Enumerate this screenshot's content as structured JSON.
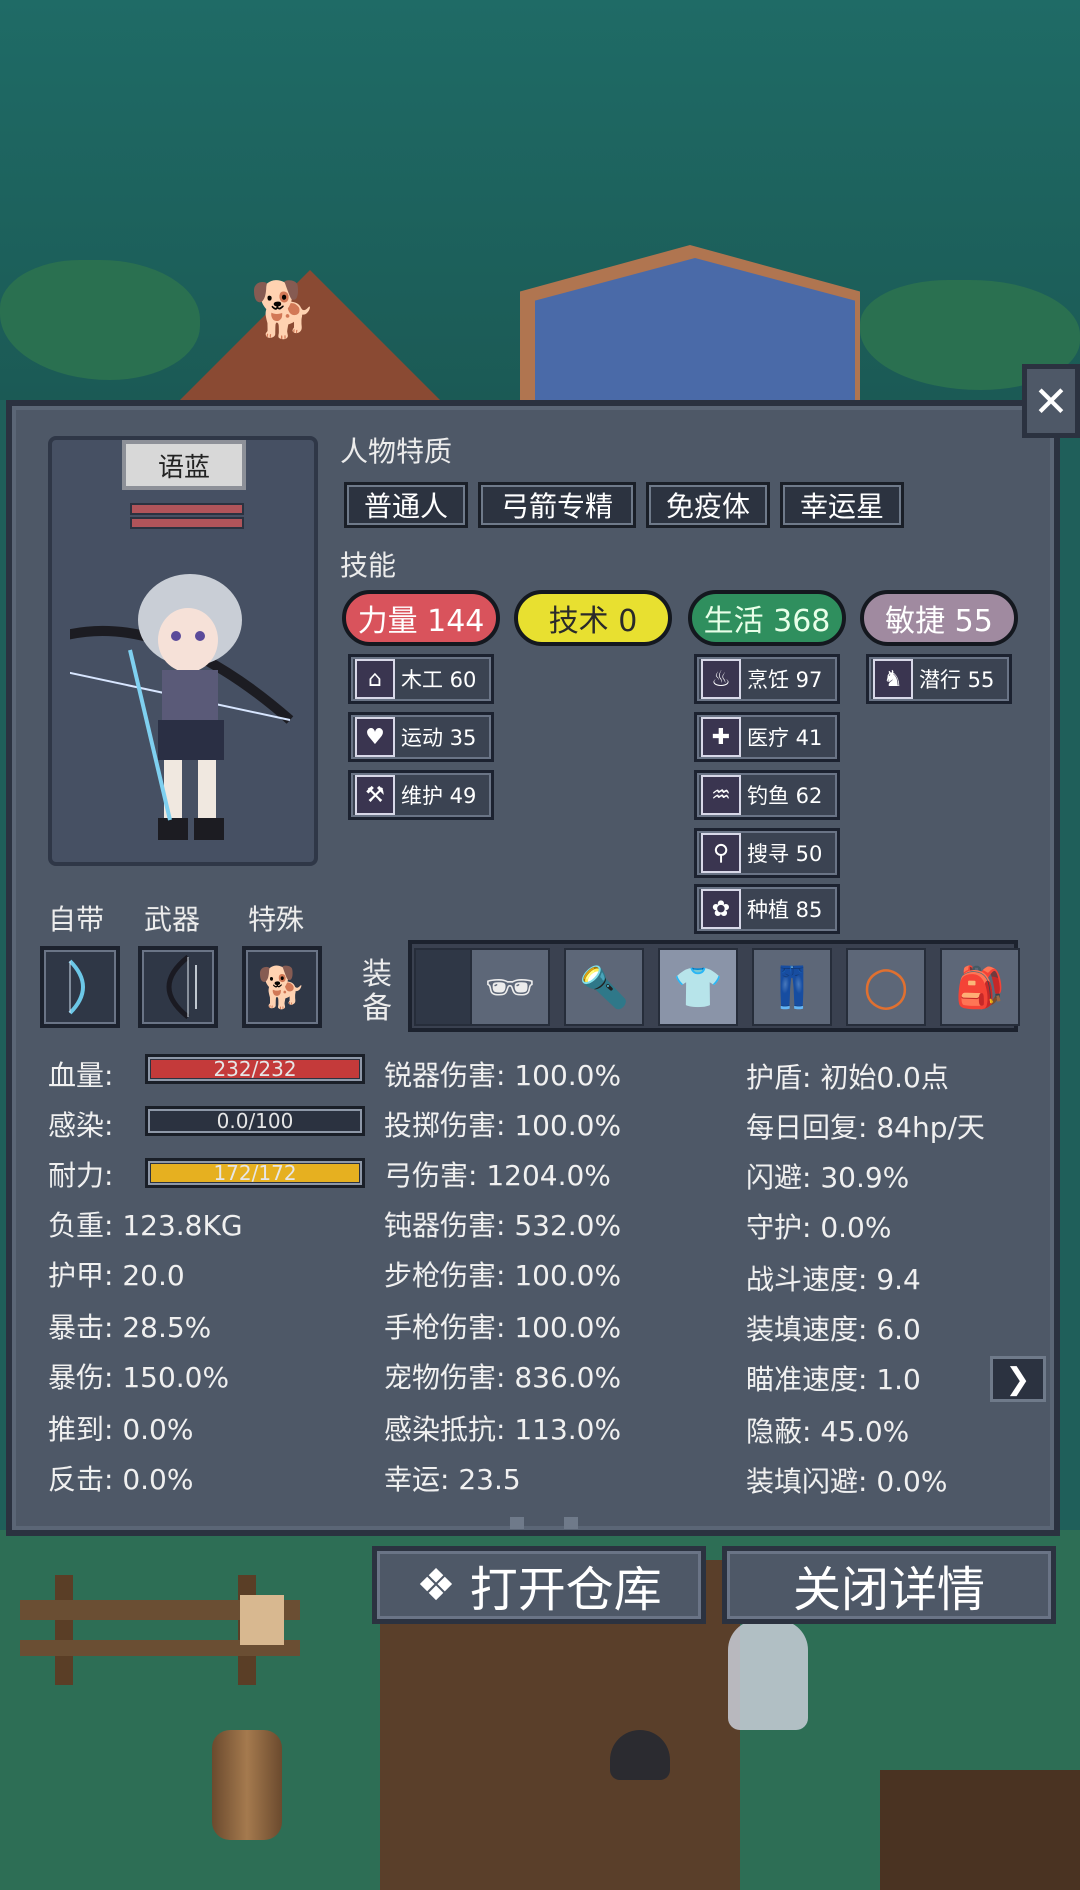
{
  "character": {
    "name": "语蓝"
  },
  "traits": {
    "title": "人物特质",
    "items": [
      "普通人",
      "弓箭专精",
      "免疫体",
      "幸运星"
    ]
  },
  "skills": {
    "title": "技能",
    "attributes": [
      {
        "label": "力量 144",
        "color": "#d9535c",
        "text_color": "#ffffff"
      },
      {
        "label": "技术 0",
        "color": "#e8e030",
        "text_color": "#2a2a2a"
      },
      {
        "label": "生活 368",
        "color": "#2f8f5e",
        "text_color": "#e8ffe8"
      },
      {
        "label": "敏捷 55",
        "color": "#a08aa0",
        "text_color": "#ffffff"
      }
    ],
    "strength": [
      {
        "icon": "house-icon",
        "glyph": "⌂",
        "label": "木工 60"
      },
      {
        "icon": "heart-icon",
        "glyph": "♥",
        "label": "运动 35"
      },
      {
        "icon": "wrench-icon",
        "glyph": "🔧",
        "label": "维护 49"
      }
    ],
    "life": [
      {
        "icon": "cooking-pot-icon",
        "glyph": "♨",
        "label": "烹饪 97"
      },
      {
        "icon": "medkit-icon",
        "glyph": "✚",
        "label": "医疗 41"
      },
      {
        "icon": "fishing-icon",
        "glyph": "♒",
        "label": "钓鱼 62"
      },
      {
        "icon": "magnifier-icon",
        "glyph": "⚲",
        "label": "搜寻 50"
      },
      {
        "icon": "plant-icon",
        "glyph": "✿",
        "label": "种植 85"
      }
    ],
    "agility": [
      {
        "icon": "sneak-icon",
        "glyph": "♞",
        "label": "潜行 55"
      }
    ]
  },
  "slots": {
    "builtin": "自带",
    "weapon": "武器",
    "special": "特殊",
    "equipment": "装备"
  },
  "stats": {
    "hp_label": "血量:",
    "hp_value": "232/232",
    "hp_ratio": 1.0,
    "infection_label": "感染:",
    "infection_value": "0.0/100",
    "infection_ratio": 0.0,
    "stamina_label": "耐力:",
    "stamina_value": "172/172",
    "stamina_ratio": 1.0,
    "col1": [
      "负重: 123.8KG",
      "护甲: 20.0",
      "暴击: 28.5%",
      "暴伤: 150.0%",
      "推到: 0.0%",
      "反击: 0.0%"
    ],
    "col2": [
      "锐器伤害: 100.0%",
      "投掷伤害: 100.0%",
      "弓伤害: 1204.0%",
      "钝器伤害: 532.0%",
      "步枪伤害: 100.0%",
      "手枪伤害: 100.0%",
      "宠物伤害: 836.0%",
      "感染抵抗: 113.0%",
      "幸运: 23.5"
    ],
    "col3": [
      "护盾: 初始0.0点",
      "每日回复: 84hp/天",
      "闪避: 30.9%",
      "守护: 0.0%",
      "战斗速度: 9.4",
      "装填速度: 6.0",
      "瞄准速度: 1.0",
      "隐蔽: 45.0%",
      "装填闪避: 0.0%"
    ]
  },
  "buttons": {
    "open_storage": "打开仓库",
    "close_details": "关闭详情"
  }
}
